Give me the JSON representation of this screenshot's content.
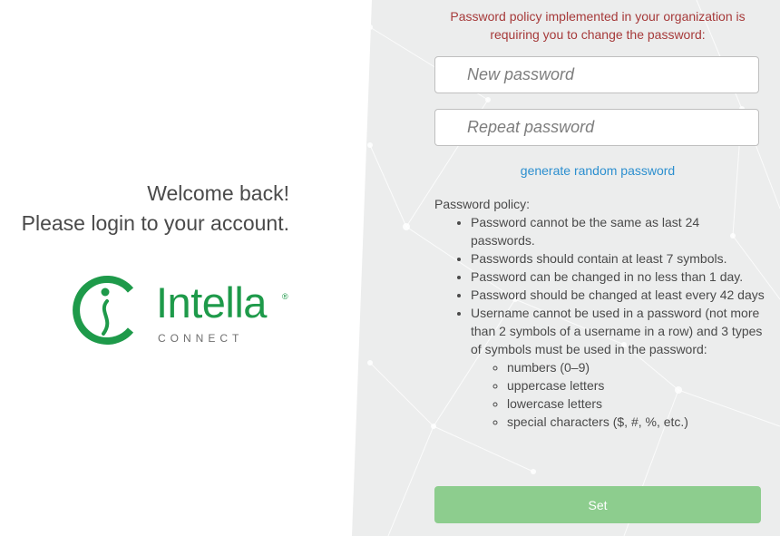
{
  "welcome": {
    "line1": "Welcome back!",
    "line2": "Please login to your account."
  },
  "logo": {
    "name": "Intella",
    "registered": "®",
    "subtitle": "CONNECT",
    "icon": "intella-logo-icon",
    "brand_color": "#1e9a4a"
  },
  "notice": {
    "text": "Password policy implemented in your organization is requiring you to change the password:",
    "color": "#a63a3a"
  },
  "form": {
    "new_password_placeholder": "New password",
    "repeat_password_placeholder": "Repeat password",
    "generate_link": "generate random password",
    "set_button": "Set",
    "button_color": "#8dcd8e",
    "link_color": "#2c8fcf"
  },
  "policy": {
    "title": "Password policy:",
    "rules": [
      "Password cannot be the same as last 24 passwords.",
      "Passwords should contain at least 7 symbols.",
      "Password can be changed in no less than 1 day.",
      "Password should be changed at least every 42 days",
      "Username cannot be used in a password (not more than 2 symbols of a username in a row) and 3 types of symbols must be used in the password:"
    ],
    "symbol_types": [
      "numbers (0–9)",
      "uppercase letters",
      "lowercase letters",
      "special characters ($, #, %, etc.)"
    ]
  }
}
